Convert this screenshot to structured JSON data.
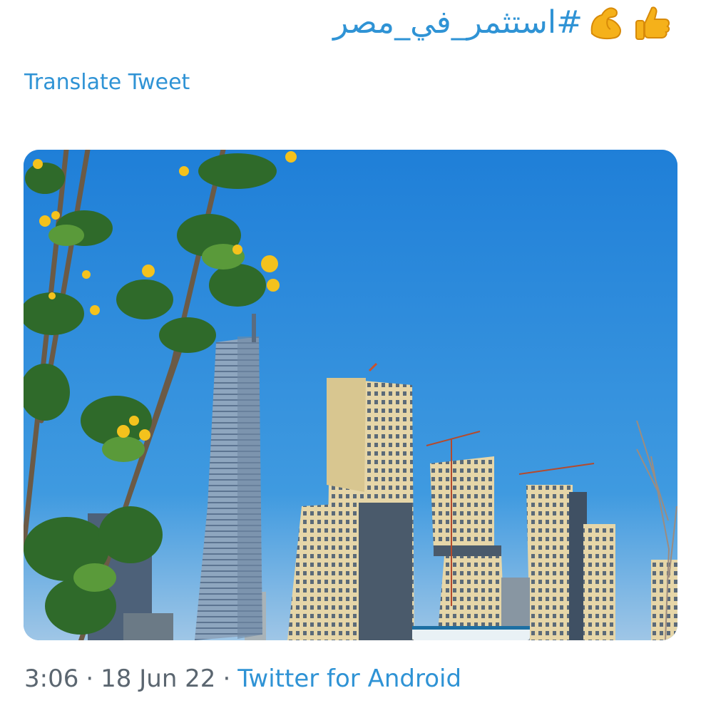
{
  "tweet": {
    "hashtag": "#استثمر_في_مصر",
    "emojis": [
      "thumbs-up-icon",
      "flexed-biceps-icon"
    ],
    "translate_label": "Translate Tweet",
    "time": "3:06",
    "separator": "·",
    "date": "18 Jun 22",
    "source": "Twitter for Android"
  },
  "colors": {
    "link": "#2f93d5",
    "meta_text": "#5b6670",
    "sky": "#2a86d6"
  }
}
